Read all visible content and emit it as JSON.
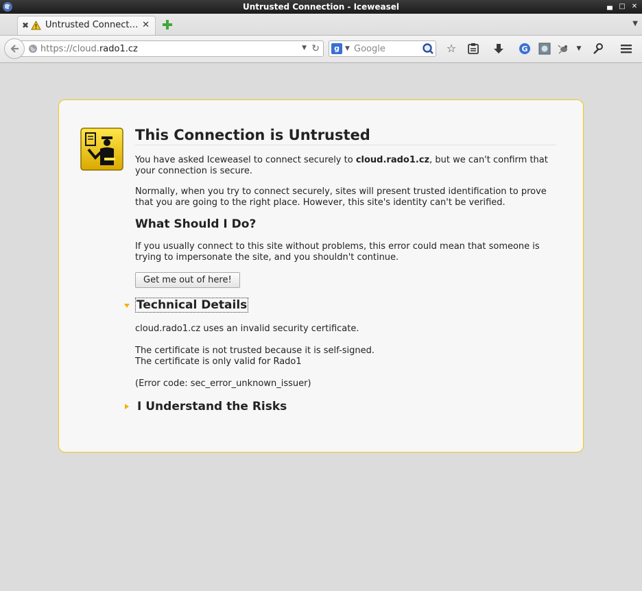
{
  "window": {
    "title": "Untrusted Connection - Iceweasel"
  },
  "tabs": [
    {
      "label": "Untrusted Connect…"
    }
  ],
  "navbar": {
    "url_prefix": "https://cloud.",
    "url_host": "rado1.cz",
    "search_placeholder": "Google"
  },
  "error": {
    "title": "This Connection is Untrusted",
    "p1_before": "You have asked Iceweasel to connect securely to ",
    "p1_host": "cloud.rado1.cz",
    "p1_after": ", but we can't confirm that your connection is secure.",
    "p2": "Normally, when you try to connect securely, sites will present trusted identification to prove that you are going to the right place. However, this site's identity can't be verified.",
    "what_heading": "What Should I Do?",
    "p3": "If you usually connect to this site without problems, this error could mean that someone is trying to impersonate the site, and you shouldn't continue.",
    "get_out_button": "Get me out of here!",
    "tech_heading": "Technical Details",
    "tech_line1": "cloud.rado1.cz uses an invalid security certificate.",
    "tech_line2": "The certificate is not trusted because it is self-signed.",
    "tech_line3": "The certificate is only valid for Rado1",
    "tech_code": "(Error code: sec_error_unknown_issuer)",
    "risk_heading": "I Understand the Risks"
  },
  "colors": {
    "accent_yellow": "#f0c419",
    "page_bg": "#dcdcdc",
    "box_bg": "#f7f7f7"
  }
}
